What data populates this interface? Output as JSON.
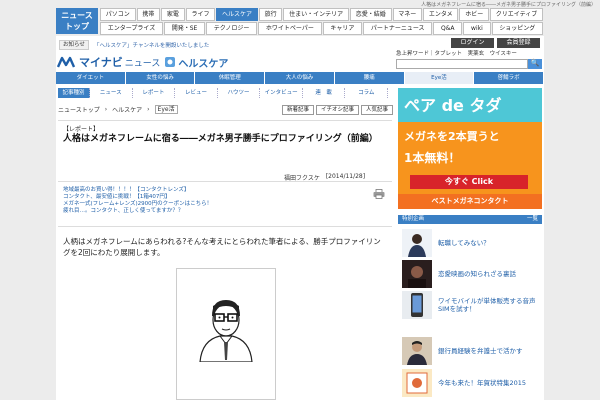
{
  "tagline": "人格はメガネフレームに宿る――メガネ男子勝手にプロファイリング（前編）",
  "top_logo": {
    "line1": "ニュース",
    "line2": "トップ"
  },
  "category_nav": {
    "row1": [
      "パソコン",
      "携帯",
      "家電",
      "ライフ",
      "ヘルスケア",
      "旅行",
      "住まい・インテリア",
      "恋愛・結婚",
      "マネー",
      "エンタメ",
      "ホビー",
      "クリエイティブ"
    ],
    "row2": [
      "エンタープライズ",
      "開発・SE",
      "テクノロジー",
      "ホワイトペーパー",
      "キャリア",
      "パートナーニュース",
      "Q&A",
      "wiki",
      "ショッピング"
    ],
    "active": "ヘルスケア"
  },
  "notice": {
    "label": "お知らせ",
    "text": "「ヘルスケア」チャンネルを開設いたしました"
  },
  "account": {
    "login": "ログイン",
    "register": "会員登録"
  },
  "brand": {
    "name": "マイナビ",
    "sub": "ニュース",
    "channel": "ヘルスケア"
  },
  "search": {
    "quick_label": "急上昇ワード",
    "words": [
      "タブレット",
      "実薬玄",
      "ウイスキー"
    ],
    "placeholder": "",
    "button": "🔍"
  },
  "sub_nav": {
    "items": [
      "ダイエット",
      "女性の悩み",
      "休眠管理",
      "大人の悩み",
      "腰痛",
      "Eye活",
      "啓鯖ラボ"
    ],
    "active": "Eye活"
  },
  "section_nav": [
    "記事種別",
    "ニュース",
    "レポート",
    "レビュー",
    "ハウツー",
    "インタビュー",
    "連　載",
    "コラム"
  ],
  "breadcrumb": {
    "items": [
      "ニューストップ",
      "ヘルスケア"
    ],
    "tag": "Eye活"
  },
  "article_tabs": [
    "新着記事",
    "イチオシ記事",
    "人気記事"
  ],
  "article": {
    "label": "【レポート】",
    "title": "人格はメガネフレームに宿る――メガネ男子勝手にプロファイリング（前編）",
    "author": "福田フクスケ",
    "date": "[2014/11/28]"
  },
  "promo_links": [
    "地域最高のお買い得！！！！【コンタクトレンズ】",
    "コンタクト、最安値に挑戦！【1箱407円】",
    "メガネ一式(フレーム+レンズ)2900円のクーポンはこちら！",
    "疲れ目…。コンタクト、正しく使ってますか？？"
  ],
  "intro": "人柄はメガネフレームにあらわれる?そんな考えにとらわれた筆者による、勝手プロファイリングを2回にわたり展開します。",
  "ad": {
    "headline": "ペア de タダ",
    "line1": "メガネを2本買うと",
    "line2": "1本無料！",
    "cta": "今すぐ Click",
    "footer": "ベストメガネコンタクト",
    "colors": {
      "orange": "#f7941d",
      "cyan": "#4ec7d6",
      "red": "#d8232a"
    }
  },
  "feature": {
    "title": "特別企画",
    "all_label": "一覧",
    "items": [
      "転職してみない？",
      "恋愛映画の知られざる裏話",
      "ワイモバイルが単体販売する音声SIMを試す！",
      "銀行員経験を弁護士で活かす",
      "今年も来た！年賀状特集2015"
    ]
  }
}
